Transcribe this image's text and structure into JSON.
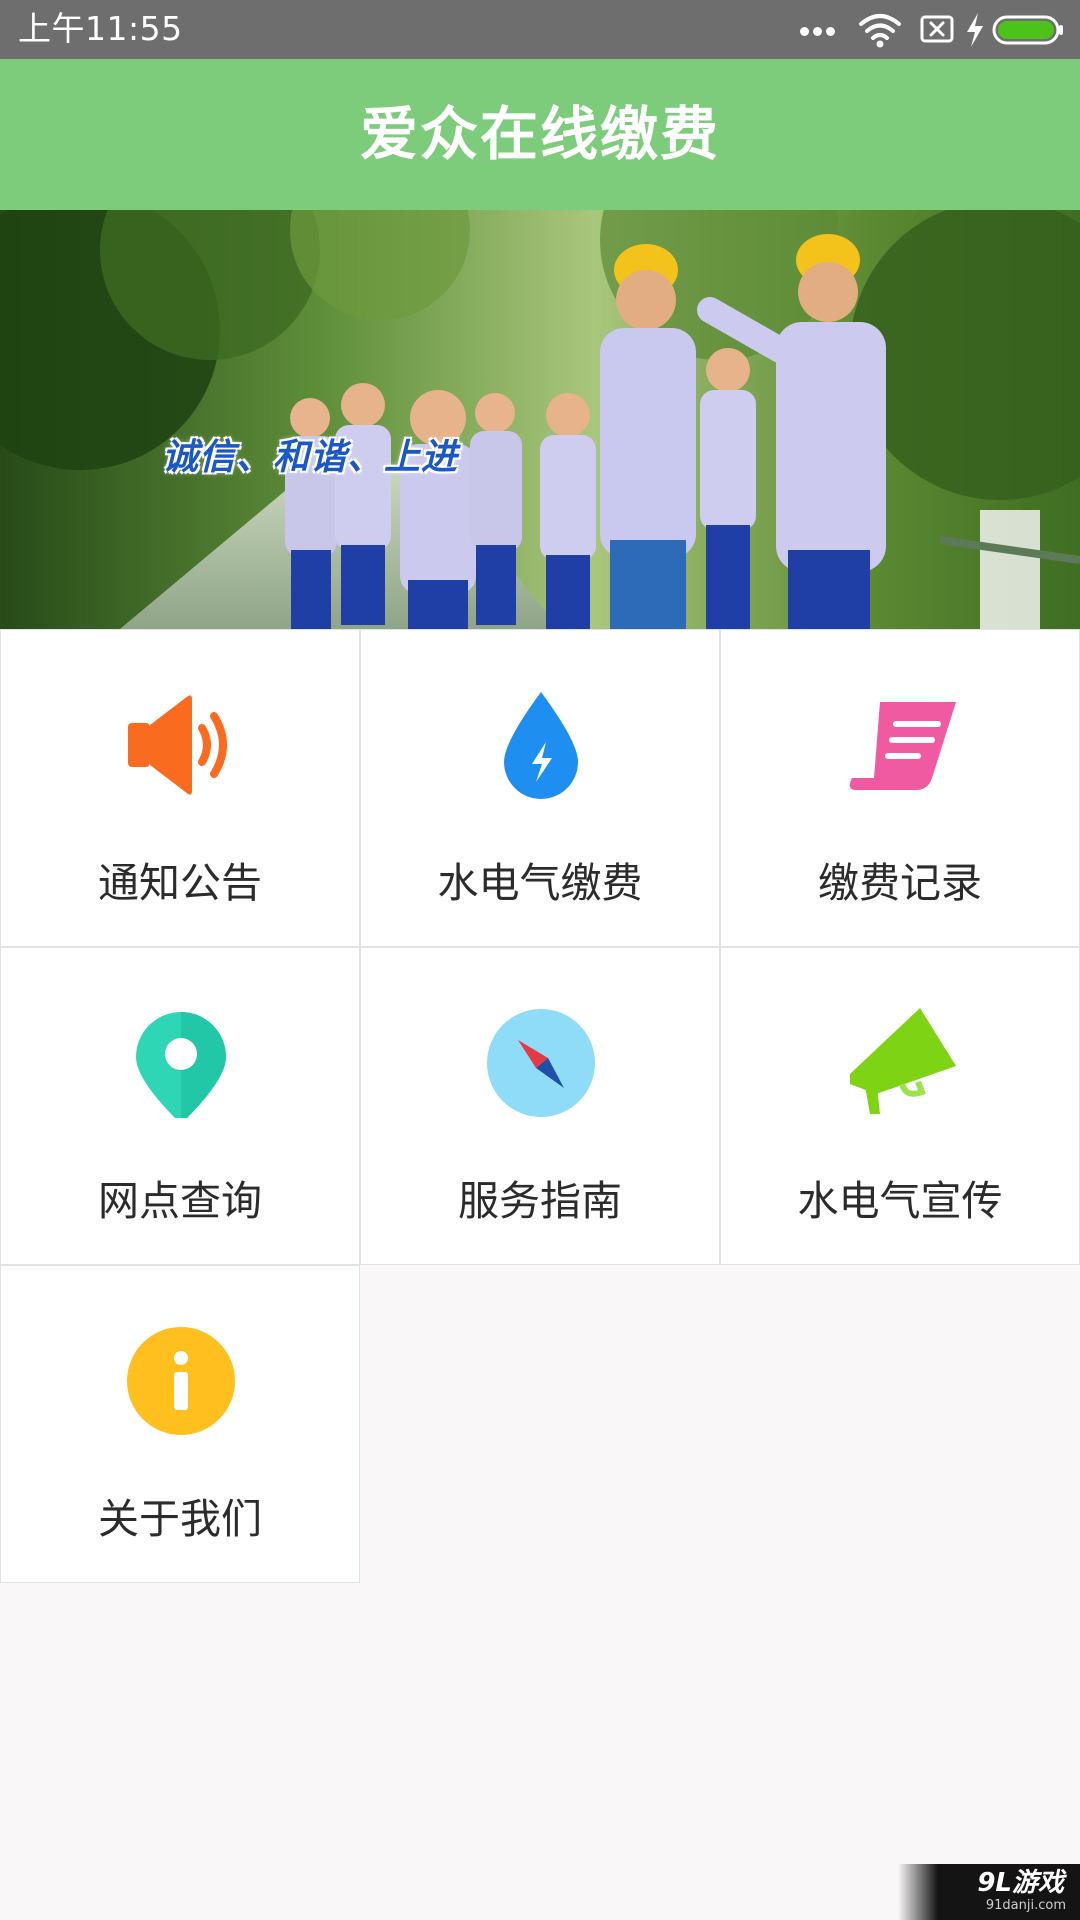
{
  "status_bar": {
    "time": "上午11:55",
    "icons": [
      "more-dots-icon",
      "wifi-icon",
      "sim-off-icon",
      "charging-bolt-icon",
      "battery-icon"
    ],
    "battery_color": "#4cc21a"
  },
  "header": {
    "title": "爱众在线缴费",
    "background_color": "#7dcc7b"
  },
  "banner": {
    "slogan": "诚信、和谐、上进"
  },
  "menu": [
    {
      "label": "通知公告",
      "icon": "speaker-icon",
      "color": "#f96c1f"
    },
    {
      "label": "水电气缴费",
      "icon": "water-drop-icon",
      "color": "#1e8ff0"
    },
    {
      "label": "缴费记录",
      "icon": "receipt-scroll-icon",
      "color": "#ef5aa0"
    },
    {
      "label": "网点查询",
      "icon": "location-pin-icon",
      "color": "#2fd6b6"
    },
    {
      "label": "服务指南",
      "icon": "compass-icon",
      "color": "#8edcf7"
    },
    {
      "label": "水电气宣传",
      "icon": "megaphone-icon",
      "color": "#7fd315"
    },
    {
      "label": "关于我们",
      "icon": "info-icon",
      "color": "#ffbf1f"
    }
  ],
  "watermark": {
    "logo": "9L游戏",
    "url": "91danji.com"
  }
}
